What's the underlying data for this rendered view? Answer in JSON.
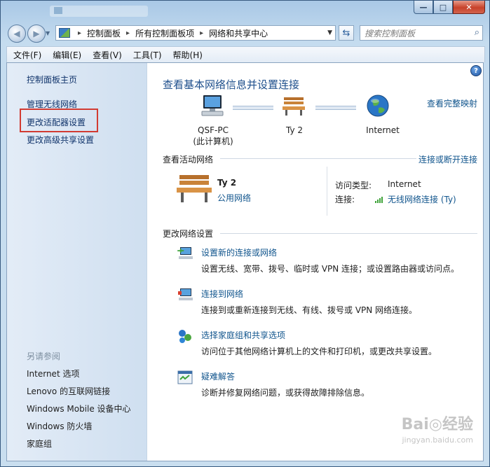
{
  "window": {
    "title": "",
    "controls": {
      "minimize": "—",
      "maximize": "□",
      "close": "✕"
    }
  },
  "address": {
    "crumbs": [
      "控制面板",
      "所有控制面板项",
      "网络和共享中心"
    ],
    "search_placeholder": "搜索控制面板"
  },
  "menu": [
    "文件(F)",
    "编辑(E)",
    "查看(V)",
    "工具(T)",
    "帮助(H)"
  ],
  "sidebar": {
    "items": [
      {
        "label": "控制面板主页"
      },
      {
        "label": "管理无线网络"
      },
      {
        "label": "更改适配器设置",
        "highlighted": true
      },
      {
        "label": "更改高级共享设置"
      }
    ],
    "see_also_title": "另请参阅",
    "see_also": [
      "Internet 选项",
      "Lenovo 的互联网链接",
      "Windows Mobile 设备中心",
      "Windows 防火墙",
      "家庭组"
    ]
  },
  "main": {
    "heading": "查看基本网络信息并设置连接",
    "full_map_link": "查看完整映射",
    "map": {
      "computer_name": "QSF-PC",
      "computer_sub": "(此计算机)",
      "network_name": "Ty  2",
      "internet": "Internet"
    },
    "active": {
      "title": "查看活动网络",
      "connect_link": "连接或断开连接",
      "network_name": "Ty  2",
      "network_type": "公用网络",
      "access_label": "访问类型:",
      "access_value": "Internet",
      "conn_label": "连接:",
      "conn_value": "无线网络连接 (Ty)"
    },
    "change": {
      "title": "更改网络设置",
      "tasks": [
        {
          "title": "设置新的连接或网络",
          "desc": "设置无线、宽带、拨号、临时或 VPN 连接；或设置路由器或访问点。",
          "icon": "new-connection-icon"
        },
        {
          "title": "连接到网络",
          "desc": "连接到或重新连接到无线、有线、拨号或 VPN 网络连接。",
          "icon": "connect-network-icon"
        },
        {
          "title": "选择家庭组和共享选项",
          "desc": "访问位于其他网络计算机上的文件和打印机，或更改共享设置。",
          "icon": "homegroup-icon"
        },
        {
          "title": "疑难解答",
          "desc": "诊断并修复网络问题，或获得故障排除信息。",
          "icon": "troubleshoot-icon"
        }
      ]
    }
  },
  "watermark": {
    "main": "Bai◎经验",
    "sub": "jingyan.baidu.com"
  },
  "colors": {
    "link": "#11558d",
    "heading": "#1e4f8c",
    "highlight_box": "#d23b32",
    "sidebar_bg": "#d6e4f3"
  }
}
